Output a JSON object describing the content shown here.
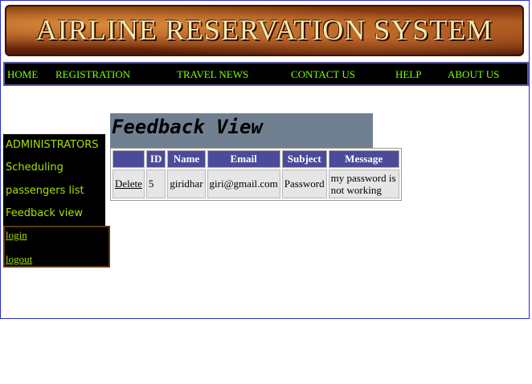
{
  "banner": {
    "title": "AIRLINE RESERVATION SYSTEM"
  },
  "nav": {
    "home": "HOME",
    "registration": "REGISTRATION",
    "travel_news": "TRAVEL NEWS",
    "contact_us": "CONTACT US",
    "help": "HELP",
    "about_us": "ABOUT US"
  },
  "sidebar": {
    "items": [
      "ADMINISTRATORS",
      "Scheduling",
      "passengers list",
      "Feedback view"
    ],
    "login": "login",
    "logout": "logout"
  },
  "main": {
    "title": "Feedback View",
    "table": {
      "headers": [
        "",
        "ID",
        "Name",
        "Email",
        "Subject",
        "Message"
      ],
      "rows": [
        {
          "action": "Delete",
          "id": "5",
          "name": "giridhar",
          "email": "giri@gmail.com",
          "subject": "Password",
          "message": "my password is not working"
        }
      ]
    }
  },
  "colors": {
    "nav_text": "#7cff00",
    "sidebar_text": "#a8e000",
    "header_bg": "#708090",
    "table_header_bg": "#4b4b9a"
  }
}
